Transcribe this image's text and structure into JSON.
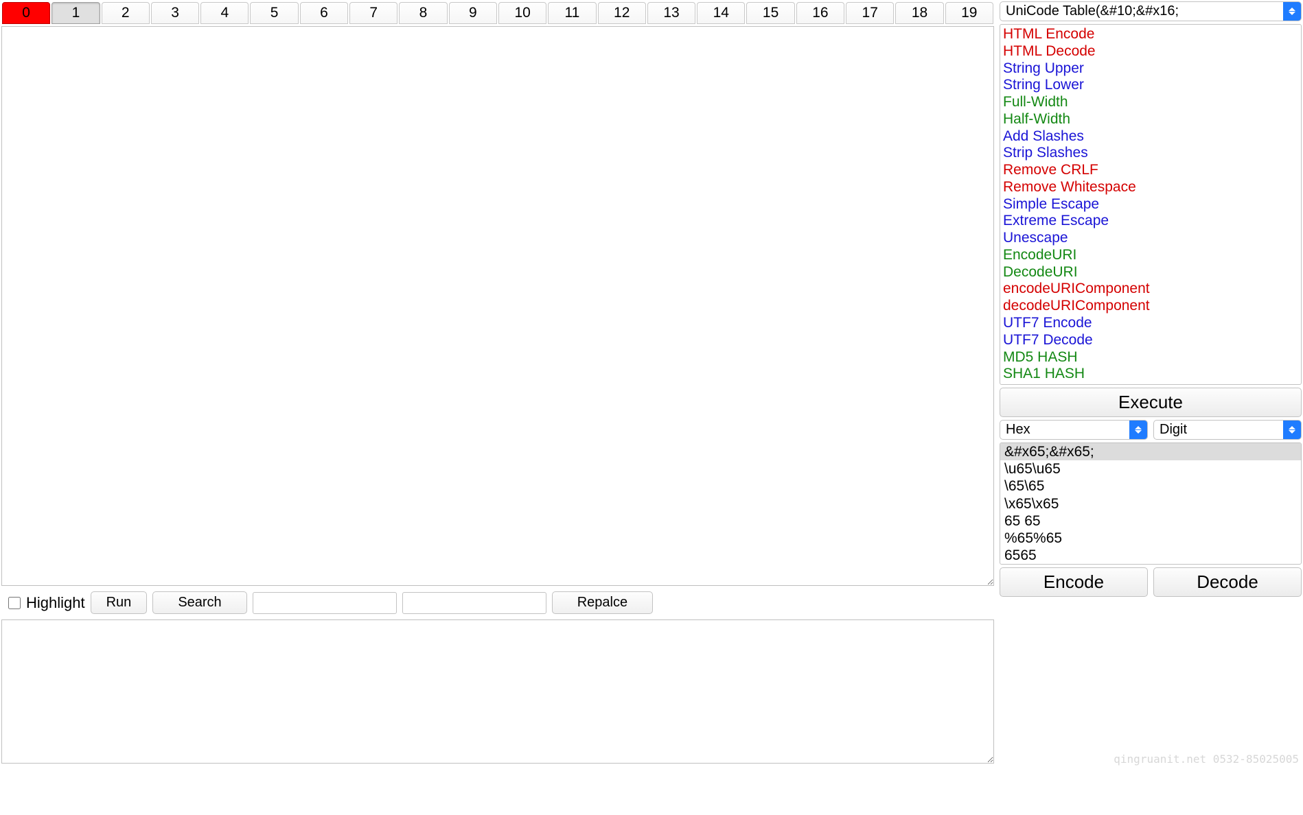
{
  "tabs": [
    "0",
    "1",
    "2",
    "3",
    "4",
    "5",
    "6",
    "7",
    "8",
    "9",
    "10",
    "11",
    "12",
    "13",
    "14",
    "15",
    "16",
    "17",
    "18",
    "19"
  ],
  "active_tabs": [
    0,
    1
  ],
  "toolbar": {
    "highlight_label": "Highlight",
    "run_label": "Run",
    "search_label": "Search",
    "replace_label": "Repalce",
    "search_value": "",
    "replace_value": ""
  },
  "top_select": {
    "text": "UniCode Table(&#10;&#x16;"
  },
  "operations": [
    {
      "label": "HTML Encode",
      "color": "red"
    },
    {
      "label": "HTML Decode",
      "color": "red"
    },
    {
      "label": "String Upper",
      "color": "blue"
    },
    {
      "label": "String Lower",
      "color": "blue"
    },
    {
      "label": "Full-Width",
      "color": "green"
    },
    {
      "label": "Half-Width",
      "color": "green"
    },
    {
      "label": "Add Slashes",
      "color": "blue"
    },
    {
      "label": "Strip Slashes",
      "color": "blue"
    },
    {
      "label": "Remove CRLF",
      "color": "red"
    },
    {
      "label": "Remove Whitespace",
      "color": "red"
    },
    {
      "label": "Simple Escape",
      "color": "blue"
    },
    {
      "label": "Extreme Escape",
      "color": "blue"
    },
    {
      "label": "Unescape",
      "color": "blue"
    },
    {
      "label": "EncodeURI",
      "color": "green"
    },
    {
      "label": "DecodeURI",
      "color": "green"
    },
    {
      "label": "encodeURIComponent",
      "color": "red"
    },
    {
      "label": "decodeURIComponent",
      "color": "red"
    },
    {
      "label": "UTF7 Encode",
      "color": "blue"
    },
    {
      "label": "UTF7 Decode",
      "color": "blue"
    },
    {
      "label": "MD5 HASH",
      "color": "green"
    },
    {
      "label": "SHA1 HASH",
      "color": "green"
    }
  ],
  "execute_label": "Execute",
  "dual": {
    "left": "Hex",
    "right": "Digit"
  },
  "encodings": [
    "&#x65;&#x65;",
    "\\u65\\u65",
    "\\65\\65",
    "\\x65\\x65",
    "65 65",
    "%65%65",
    "6565"
  ],
  "encodings_selected": 0,
  "encode_label": "Encode",
  "decode_label": "Decode",
  "watermark": "qingruanit.net 0532-85025005"
}
